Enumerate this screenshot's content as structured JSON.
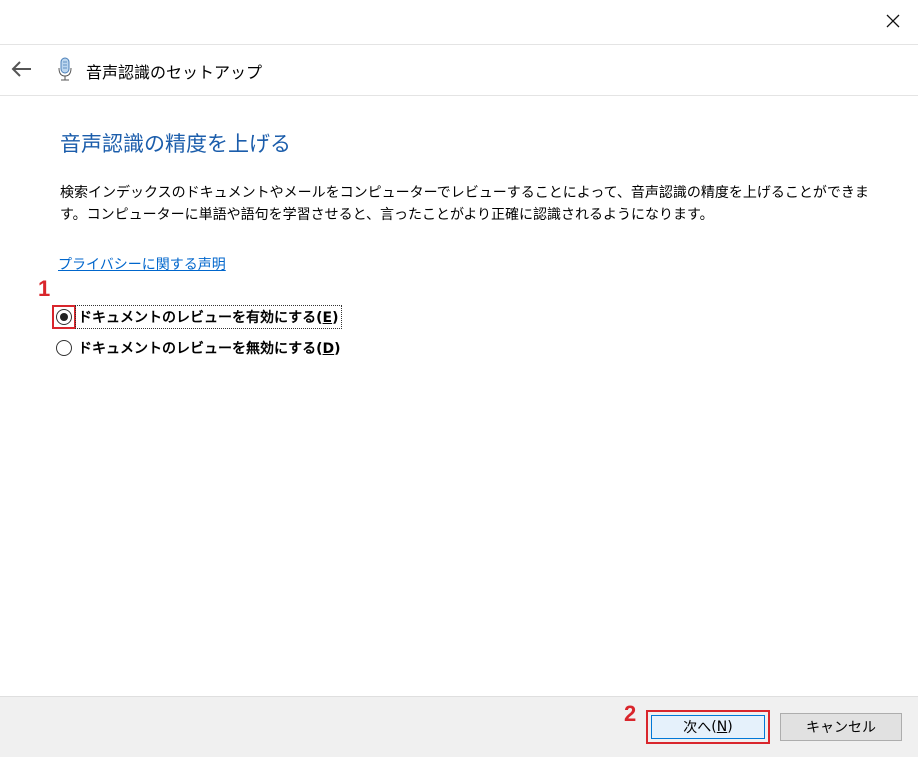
{
  "window": {
    "title": "音声認識のセットアップ"
  },
  "page": {
    "heading": "音声認識の精度を上げる",
    "description": "検索インデックスのドキュメントやメールをコンピューターでレビューすることによって、音声認識の精度を上げることができます。コンピューターに単語や語句を学習させると、言ったことがより正確に認識されるようになります。",
    "privacy_link": "プライバシーに関する声明"
  },
  "annotations": {
    "marker1": "1",
    "marker2": "2"
  },
  "options": [
    {
      "label": "ドキュメントのレビューを有効にする",
      "accel_prefix": "(",
      "accel": "E",
      "accel_suffix": ")",
      "checked": true
    },
    {
      "label": "ドキュメントのレビューを無効にする",
      "accel_prefix": "(",
      "accel": "D",
      "accel_suffix": ")",
      "checked": false
    }
  ],
  "buttons": {
    "next_label": "次へ",
    "next_accel_prefix": "(",
    "next_accel": "N",
    "next_accel_suffix": ")",
    "cancel_label": "キャンセル"
  },
  "icons": {
    "close": "close-icon",
    "back": "back-arrow-icon",
    "microphone": "microphone-icon"
  },
  "colors": {
    "heading": "#1b5dab",
    "link": "#0066cc",
    "annotation": "#d9262c"
  }
}
